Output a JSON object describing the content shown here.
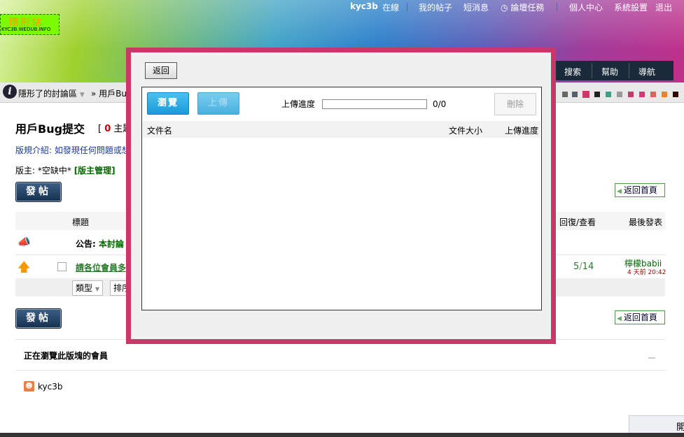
{
  "header": {
    "logo_text": "隱形站",
    "logo_sub": "KYC3B.WEDUB.INFO",
    "username": "kyc3b",
    "online": "在線",
    "nav": [
      "我的帖子",
      "短消息",
      "論壇任務",
      "個人中心",
      "系統設置",
      "退出"
    ],
    "menu": [
      "搜索",
      "幫助",
      "導航"
    ]
  },
  "breadcrumb": {
    "forum": "隱形了的討論區",
    "current": "» 用戶Bu"
  },
  "theme_colors": [
    "#666666",
    "#55606a",
    "#c83868",
    "#222222",
    "#3aa088",
    "#9a9a9a",
    "#c83868",
    "#d23a78",
    "#e06060",
    "#f08020",
    "#330000",
    "#eeeeee"
  ],
  "main": {
    "title": "用戶Bug提交",
    "title_count_prefix": "[",
    "title_count": "0",
    "title_count_suffix": "主題",
    "intro": "版規介紹: 如發現任何問題或想",
    "moderator_label": "版主: *空缺中*",
    "moderator_link": "[版主管理]",
    "post_button": "發帖",
    "home_button": "返回首頁",
    "columns": {
      "title": "標題",
      "replies": "回復/查看",
      "last": "最後發表"
    },
    "announcement_label": "公告:",
    "announcement_text": "本討論",
    "thread": {
      "title": "請各位會員多",
      "replies": "5",
      "slash": "/",
      "views": "14",
      "last_user": "檸檬babii",
      "last_time": "4 天前 20:42"
    },
    "filter_type": "類型",
    "filter_sort": "排序",
    "browsing_title": "正在瀏覽此版塊的會員",
    "browsing_user": "kyc3b",
    "bottom_right": "開"
  },
  "modal": {
    "back_label": "返回",
    "browse_label": "瀏覽",
    "upload_label": "上傳",
    "progress_label": "上傳進度",
    "progress_value": 0,
    "progress_text": "0/0",
    "delete_label": "刪除",
    "col_filename": "文件名",
    "col_filesize": "文件大小",
    "col_progress": "上傳進度"
  }
}
